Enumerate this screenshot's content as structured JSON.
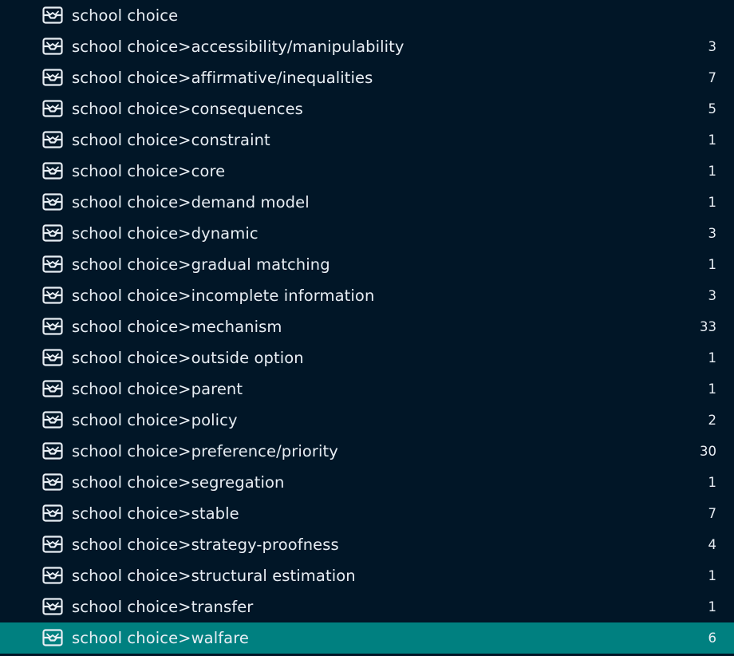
{
  "tag_tree": {
    "icon": "tray-icon",
    "selected_index": 20,
    "colors": {
      "background": "#011627",
      "selected_background": "#008080",
      "text": "#e8eef4"
    },
    "items": [
      {
        "label": "school choice",
        "count": ""
      },
      {
        "label": "school choice>accessibility/manipulability",
        "count": "3"
      },
      {
        "label": "school choice>affirmative/inequalities",
        "count": "7"
      },
      {
        "label": "school choice>consequences",
        "count": "5"
      },
      {
        "label": "school choice>constraint",
        "count": "1"
      },
      {
        "label": "school choice>core",
        "count": "1"
      },
      {
        "label": "school choice>demand model",
        "count": "1"
      },
      {
        "label": "school choice>dynamic",
        "count": "3"
      },
      {
        "label": "school choice>gradual matching",
        "count": "1"
      },
      {
        "label": "school choice>incomplete information",
        "count": "3"
      },
      {
        "label": "school choice>mechanism",
        "count": "33"
      },
      {
        "label": "school choice>outside option",
        "count": "1"
      },
      {
        "label": "school choice>parent",
        "count": "1"
      },
      {
        "label": "school choice>policy",
        "count": "2"
      },
      {
        "label": "school choice>preference/priority",
        "count": "30"
      },
      {
        "label": "school choice>segregation",
        "count": "1"
      },
      {
        "label": "school choice>stable",
        "count": "7"
      },
      {
        "label": "school choice>strategy-proofness",
        "count": "4"
      },
      {
        "label": "school choice>structural estimation",
        "count": "1"
      },
      {
        "label": "school choice>transfer",
        "count": "1"
      },
      {
        "label": "school choice>walfare",
        "count": "6"
      }
    ]
  }
}
